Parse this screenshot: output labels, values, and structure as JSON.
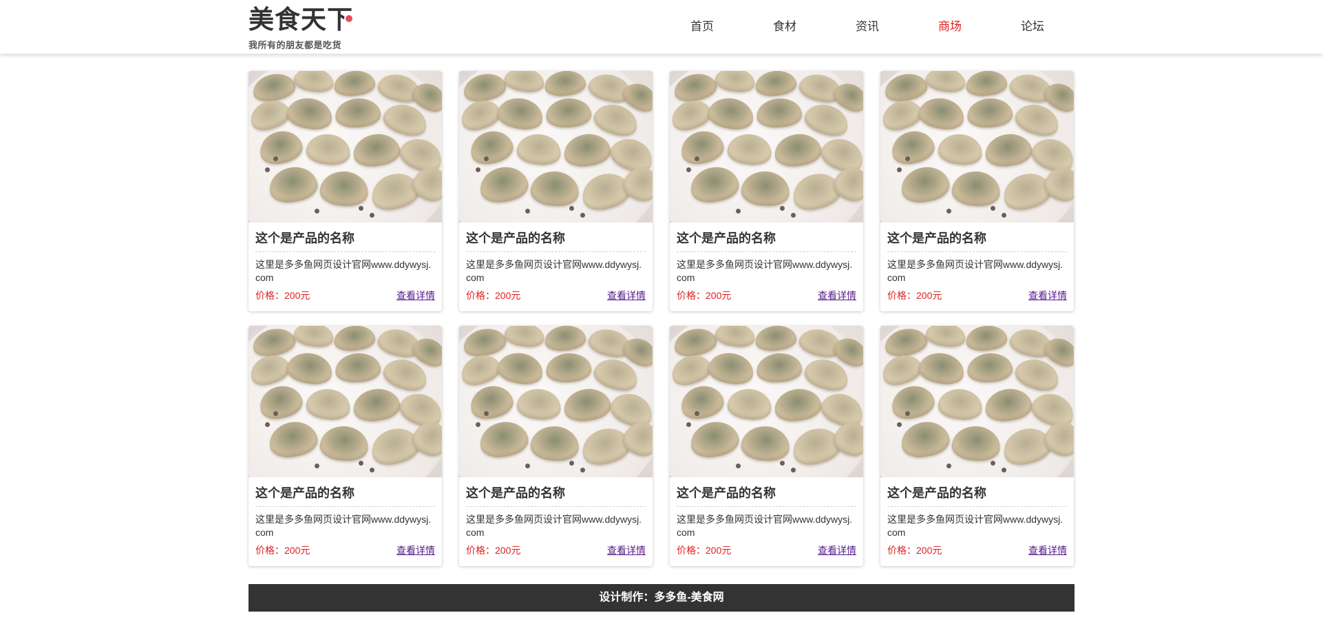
{
  "header": {
    "logo_title": "美食天下",
    "logo_subtitle": "我所有的朋友都是吃货",
    "nav": [
      {
        "label": "首页",
        "active": false
      },
      {
        "label": "食材",
        "active": false
      },
      {
        "label": "资讯",
        "active": false
      },
      {
        "label": "商场",
        "active": true
      },
      {
        "label": "论坛",
        "active": false
      }
    ],
    "active_color": "#e02020"
  },
  "products": [
    {
      "name": "这个是产品的名称",
      "desc": "这里是多多鱼网页设计官网www.ddywysj.com",
      "price": "价格：200元",
      "link": "查看详情",
      "image": "dumplings-photo"
    },
    {
      "name": "这个是产品的名称",
      "desc": "这里是多多鱼网页设计官网www.ddywysj.com",
      "price": "价格：200元",
      "link": "查看详情",
      "image": "dumplings-photo"
    },
    {
      "name": "这个是产品的名称",
      "desc": "这里是多多鱼网页设计官网www.ddywysj.com",
      "price": "价格：200元",
      "link": "查看详情",
      "image": "dumplings-photo"
    },
    {
      "name": "这个是产品的名称",
      "desc": "这里是多多鱼网页设计官网www.ddywysj.com",
      "price": "价格：200元",
      "link": "查看详情",
      "image": "dumplings-photo"
    },
    {
      "name": "这个是产品的名称",
      "desc": "这里是多多鱼网页设计官网www.ddywysj.com",
      "price": "价格：200元",
      "link": "查看详情",
      "image": "dumplings-photo"
    },
    {
      "name": "这个是产品的名称",
      "desc": "这里是多多鱼网页设计官网www.ddywysj.com",
      "price": "价格：200元",
      "link": "查看详情",
      "image": "dumplings-photo"
    },
    {
      "name": "这个是产品的名称",
      "desc": "这里是多多鱼网页设计官网www.ddywysj.com",
      "price": "价格：200元",
      "link": "查看详情",
      "image": "dumplings-photo"
    },
    {
      "name": "这个是产品的名称",
      "desc": "这里是多多鱼网页设计官网www.ddywysj.com",
      "price": "价格：200元",
      "link": "查看详情",
      "image": "dumplings-photo"
    }
  ],
  "footer": {
    "text": "设计制作：多多鱼-美食网",
    "background": "#333333"
  }
}
